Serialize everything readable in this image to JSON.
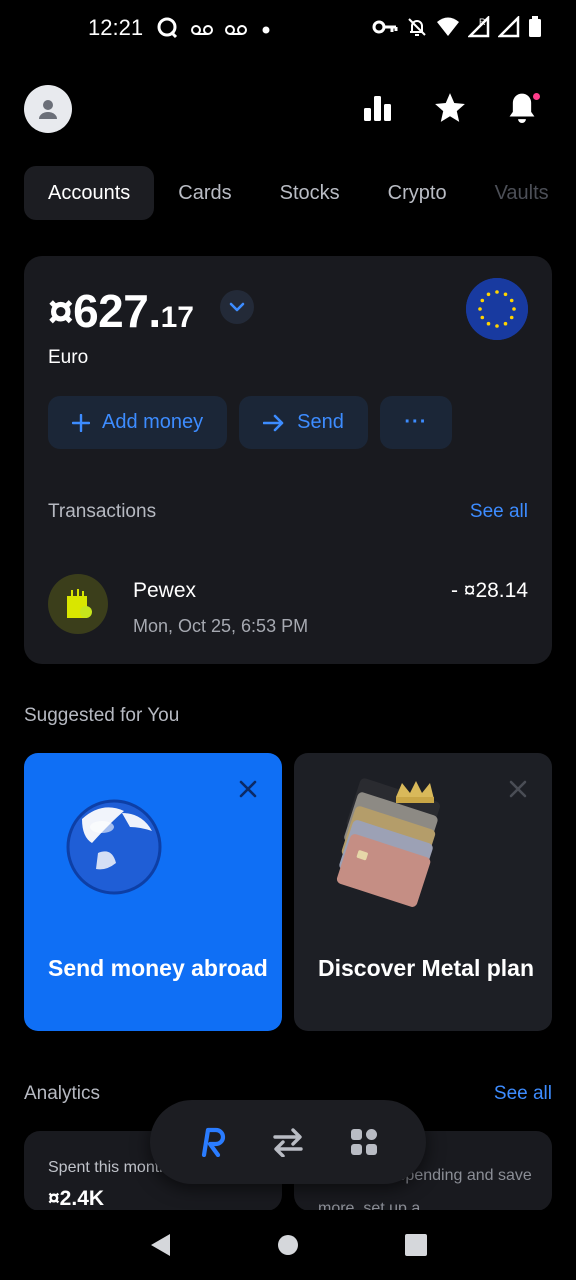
{
  "status_bar": {
    "time": "12:21",
    "left_icons": [
      "assistant-icon",
      "voicemail-icon",
      "voicemail-icon",
      "dot-icon"
    ],
    "right_icons": [
      "vpn-key-icon",
      "mute-icon",
      "wifi-icon",
      "signal-roaming-icon",
      "signal-icon",
      "battery-icon"
    ]
  },
  "header": {
    "icons": [
      "analytics-icon",
      "star-icon",
      "bell-icon"
    ]
  },
  "tabs": [
    {
      "label": "Accounts",
      "active": true
    },
    {
      "label": "Cards",
      "active": false
    },
    {
      "label": "Stocks",
      "active": false
    },
    {
      "label": "Crypto",
      "active": false
    },
    {
      "label": "Vaults",
      "active": false
    }
  ],
  "account": {
    "balance_main": "¤627.",
    "balance_decimal": "17",
    "currency_name": "Euro",
    "flag": "eu-flag-icon",
    "actions": {
      "add_money": "Add money",
      "send": "Send",
      "more": "···"
    },
    "transactions_title": "Transactions",
    "see_all": "See all",
    "transaction": {
      "merchant": "Pewex",
      "date": "Mon, Oct 25, 6:53 PM",
      "amount": "- ¤28.14"
    }
  },
  "suggested": {
    "title": "Suggested for You",
    "cards": [
      {
        "text": "Send money abroad",
        "image": "globe-icon"
      },
      {
        "text": "Discover Metal plan",
        "image": "metal-cards-crown-icon"
      }
    ]
  },
  "analytics": {
    "title": "Analytics",
    "see_all": "See all",
    "spent_label": "Spent this month",
    "spent_value": "¤2.4K",
    "track_text": "Track your spending and save more, set up a"
  },
  "bottom_pill": [
    "revolut-home-icon",
    "transfers-icon",
    "hub-icon"
  ],
  "colors": {
    "accent": "#3d8cff",
    "card_bg": "#191a1f",
    "promo_blue": "#0f6ff5"
  }
}
